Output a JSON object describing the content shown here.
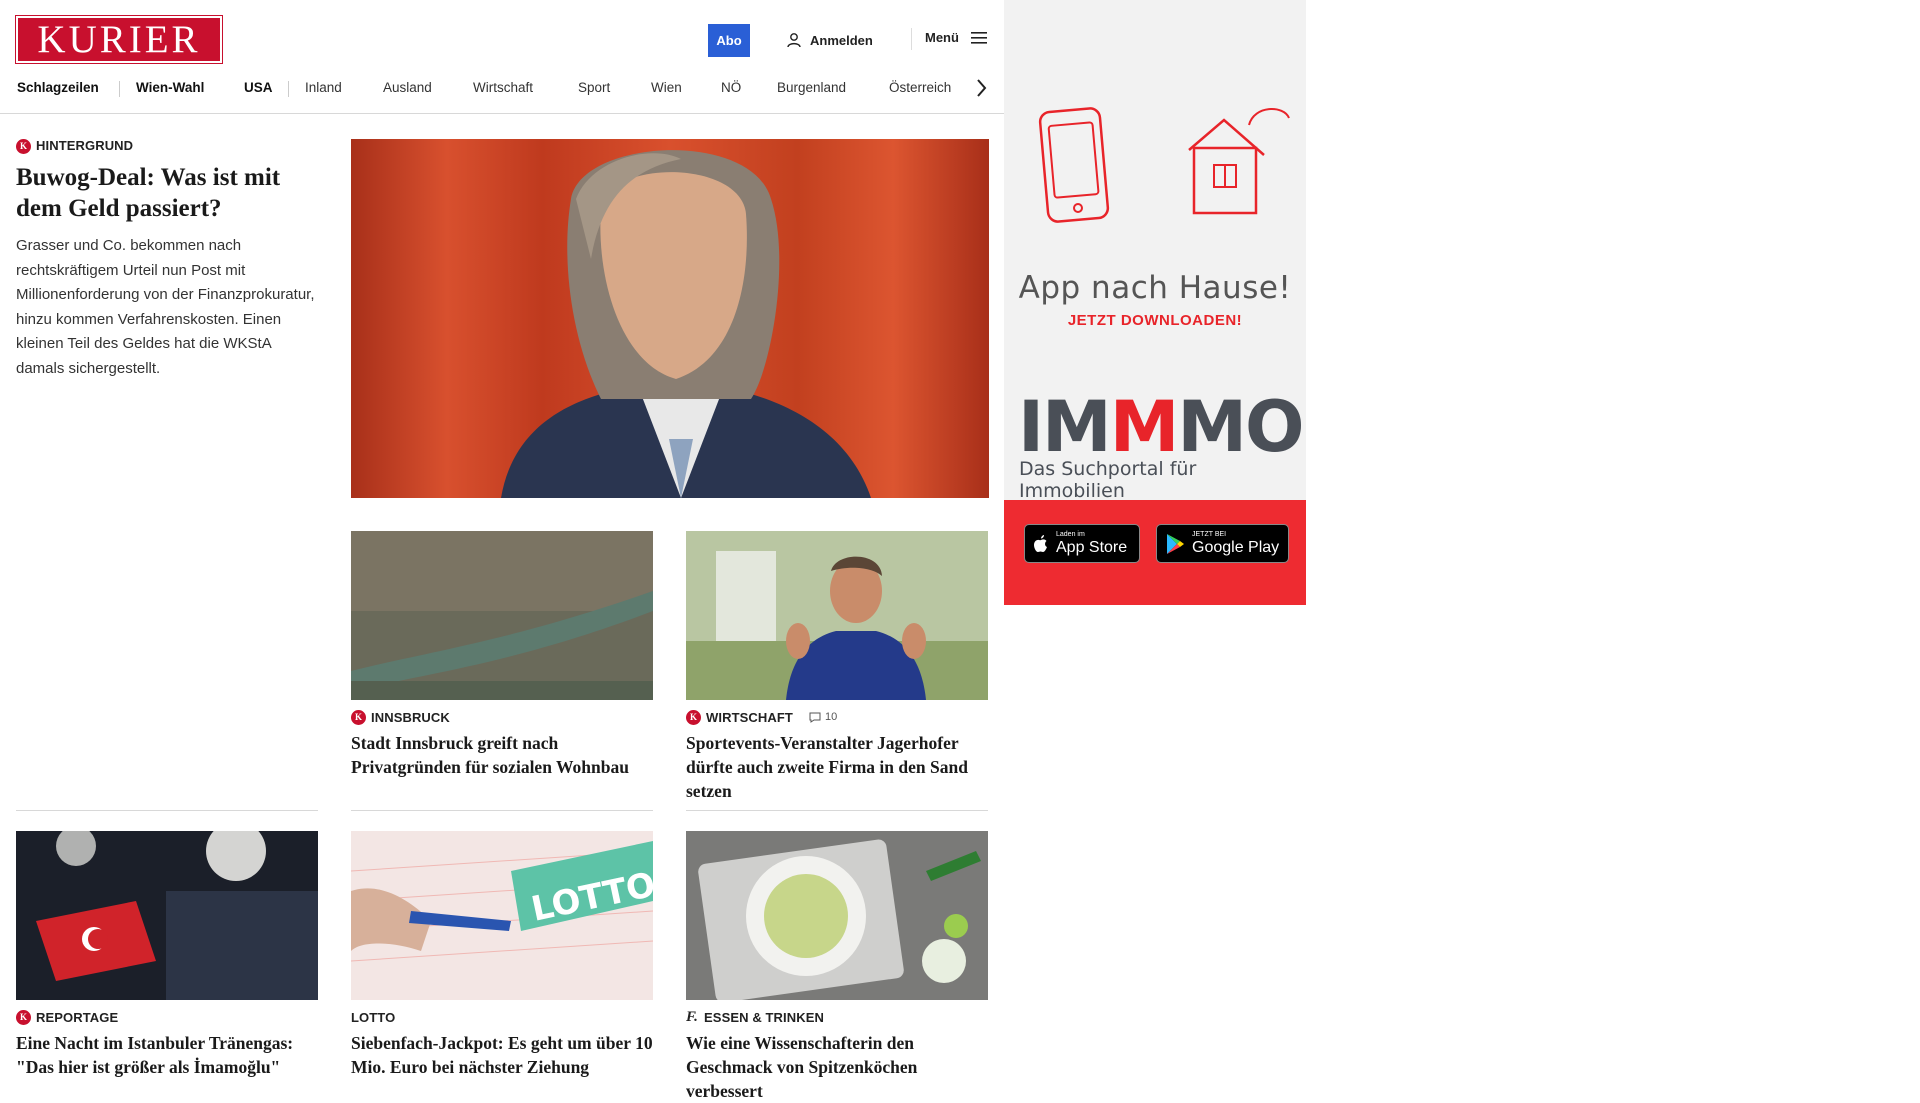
{
  "header": {
    "logo": "KURIER",
    "abo": "Abo",
    "login": "Anmelden",
    "menu": "Menü"
  },
  "nav": [
    "Schlagzeilen",
    "Wien-Wahl",
    "USA",
    "Inland",
    "Ausland",
    "Wirtschaft",
    "Sport",
    "Wien",
    "NÖ",
    "Burgenland",
    "Österreich"
  ],
  "hero": {
    "kicker": "HINTERGRUND",
    "headline": "Buwog-Deal: Was ist mit dem Geld passiert?",
    "teaser": "Grasser und Co. bekommen nach rechtskräftigem Urteil nun Post mit Millionenforderung von der Finanzprokuratur, hinzu kommen Verfahrenskosten. Einen kleinen Teil des Geldes hat die WKStA damals sichergestellt."
  },
  "cards": [
    {
      "kicker": "INNSBRUCK",
      "headline": "Stadt Innsbruck greift nach Privatgründen für sozialen Wohnbau"
    },
    {
      "kicker": "WIRTSCHAFT",
      "comments": "10",
      "headline": "Sportevents-Veranstalter Jagerhofer dürfte auch zweite Firma in den Sand setzen"
    },
    {
      "kicker": "REPORTAGE",
      "headline": "Eine Nacht im Istanbuler Tränengas: \"Das hier ist größer als İmamoğlu\""
    },
    {
      "kicker": "LOTTO",
      "headline": "Siebenfach-Jackpot: Es geht um über 10 Mio. Euro bei nächster Ziehung"
    },
    {
      "kicker": "ESSEN & TRINKEN",
      "headline": "Wie eine Wissenschafterin den Geschmack von Spitzenköchen verbessert"
    }
  ],
  "lotto_ticket_text": "LOTTO",
  "ad": {
    "title": "App nach Hause!",
    "cta": "JETZT DOWNLOADEN!",
    "brand_a": "IM",
    "brand_m": "M",
    "brand_b": "MO",
    "tagline": "Das Suchportal für Immobilien",
    "appstore_small": "Laden im",
    "appstore_big": "App Store",
    "googleplay_small": "JETZT BEI",
    "googleplay_big": "Google Play"
  },
  "colors": {
    "brand_red": "#c8102e",
    "abo_blue": "#2a5fd6",
    "ad_red": "#ee2b31"
  }
}
